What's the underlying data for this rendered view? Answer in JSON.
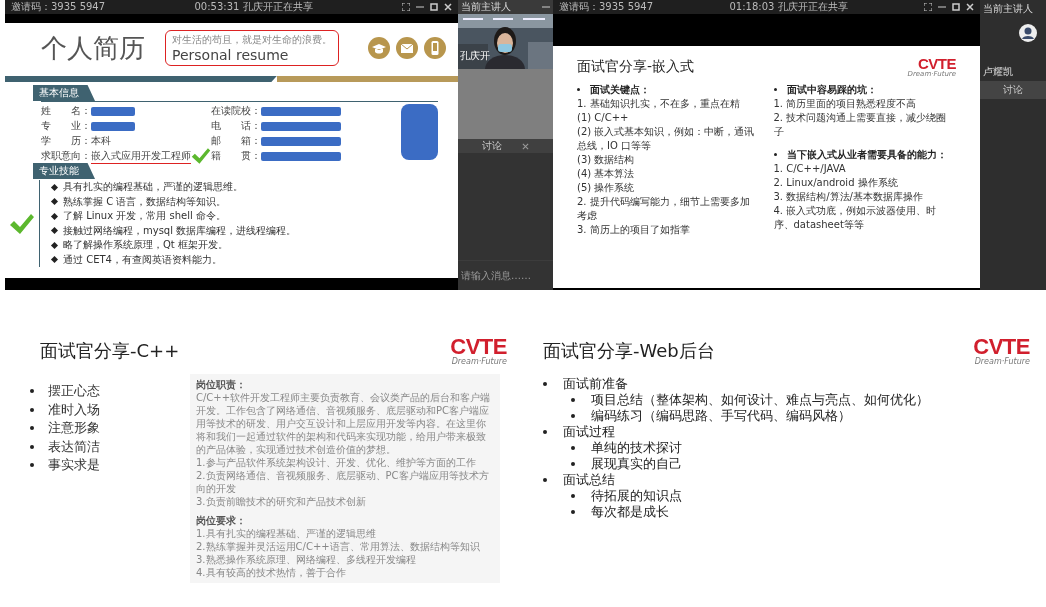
{
  "resume_window": {
    "invite_code": "邀请码：3935 5947",
    "share_status": "00:53:31 孔庆开正在共享",
    "slide": {
      "title": "个人简历",
      "motto": "对生活的苟且，就是对生命的浪费。",
      "subtitle": "Personal resume",
      "basic_info": {
        "heading": "基本信息",
        "fields": [
          {
            "label": "姓　　名：",
            "redacted": true,
            "underlined": false
          },
          {
            "label": "在读院校：",
            "redacted": true,
            "underlined": false
          },
          {
            "label": "专　　业：",
            "redacted": true,
            "underlined": false
          },
          {
            "label": "电　　话：",
            "redacted": true,
            "underlined": false
          },
          {
            "label": "学　　历：",
            "value": "本科",
            "redacted": false,
            "underlined": false
          },
          {
            "label": "邮　　箱：",
            "redacted": true,
            "underlined": false
          },
          {
            "label": "求职意向：",
            "value": "嵌入式应用开发工程师",
            "redacted": false,
            "underlined": true
          },
          {
            "label": "籍　　贯：",
            "redacted": true,
            "underlined": false
          }
        ]
      },
      "skills": {
        "heading": "专业技能",
        "items": [
          "具有扎实的编程基础，严谨的逻辑思维。",
          "熟练掌握 C 语言，数据结构等知识。",
          "了解 Linux 开发，常用 shell 命令。",
          "接触过网络编程，mysql 数据库编程，进线程编程。",
          "略了解操作系统原理，Qt 框架开发。",
          "通过 CET4，有查阅英语资料能力。"
        ]
      }
    }
  },
  "participant_panel": {
    "header": "当前主讲人",
    "video_label": "孔庆开",
    "chat_title": "讨论",
    "chat_placeholder": "请输入消息……"
  },
  "embedded_window": {
    "invite_code": "邀请码：3935 5947",
    "share_status": "01:18:03 孔庆开正在共享",
    "slide": {
      "title": "面试官分享-嵌入式",
      "logo": {
        "name": "CVTE",
        "tagline": "Dream·Future"
      },
      "columns": [
        [
          {
            "heading": "面试关键点：",
            "lines": [
              "1. 基础知识扎实，不在多，重点在精",
              "(1) C/C++",
              "(2) 嵌入式基本知识，例如：中断，通讯总线，IO 口等等",
              "(3) 数据结构",
              "(4) 基本算法",
              "(5) 操作系统",
              "2. 提升代码编写能力，细节上需要多加考虑",
              "3. 简历上的项目了如指掌"
            ]
          }
        ],
        [
          {
            "heading": "面试中容易踩的坑：",
            "lines": [
              "1. 简历里面的项目熟悉程度不高",
              "2. 技术问题沟通上需要直接，减少绕圈子"
            ]
          },
          {
            "heading": "当下嵌入式从业者需要具备的能力：",
            "lines": [
              "1. C/C++/JAVA",
              "2. Linux/android 操作系统",
              "3. 数据结构/算法/基本数据库操作",
              "4. 嵌入式功底，例如示波器使用、时序、datasheet等等"
            ]
          }
        ]
      ]
    }
  },
  "speaker_panel": {
    "header": "当前主讲人",
    "name": "卢耀凯",
    "tab": "讨论"
  },
  "cpp_slide": {
    "title": "面试官分享-C++",
    "logo": {
      "name": "CVTE",
      "tagline": "Dream·Future"
    },
    "bullets": [
      "摆正心态",
      "准时入场",
      "注意形象",
      "表达简洁",
      "事实求是"
    ],
    "job_sections": [
      {
        "heading": "岗位职责：",
        "lines": [
          "C/C++软件开发工程师主要负责教育、会议类产品的后台和客户端开发。工作包含了网络通信、音视频服务、底层驱动和PC客户端应用等技术的研发、用户交互设计和上层应用开发等内容。在这里你将和我们一起通过软件的架构和代码来实现功能，给用户带来极致的产品体验，实现通过技术创造价值的梦想。",
          "1.参与产品软件系统架构设计、开发、优化、维护等方面的工作",
          "2.负责网络通信、音视频服务、底层驱动、PC客户端应用等技术方向的开发",
          "3.负责前瞻技术的研究和产品技术创新"
        ]
      },
      {
        "heading": "岗位要求：",
        "lines": [
          "1.具有扎实的编程基础、严谨的逻辑思维",
          "2.熟练掌握并灵活运用C/C++语言、常用算法、数据结构等知识",
          "3.熟悉操作系统原理、网络编程、多线程开发编程",
          "4.具有较高的技术热情，善于合作"
        ]
      }
    ]
  },
  "web_slide": {
    "title": "面试官分享-Web后台",
    "logo": {
      "name": "CVTE",
      "tagline": "Dream·Future"
    },
    "bullets": [
      {
        "text": "面试前准备",
        "children": [
          {
            "text": "项目总结（整体架构、如何设计、难点与亮点、如何优化）"
          },
          {
            "text": "编码练习（编码思路、手写代码、编码风格）"
          }
        ]
      },
      {
        "text": "面试过程",
        "children": [
          {
            "text": "单纯的技术探讨"
          },
          {
            "text": "展现真实的自己"
          }
        ]
      },
      {
        "text": "面试总结",
        "children": [
          {
            "text": "待拓展的知识点"
          },
          {
            "text": "每次都是成长"
          }
        ]
      }
    ]
  }
}
